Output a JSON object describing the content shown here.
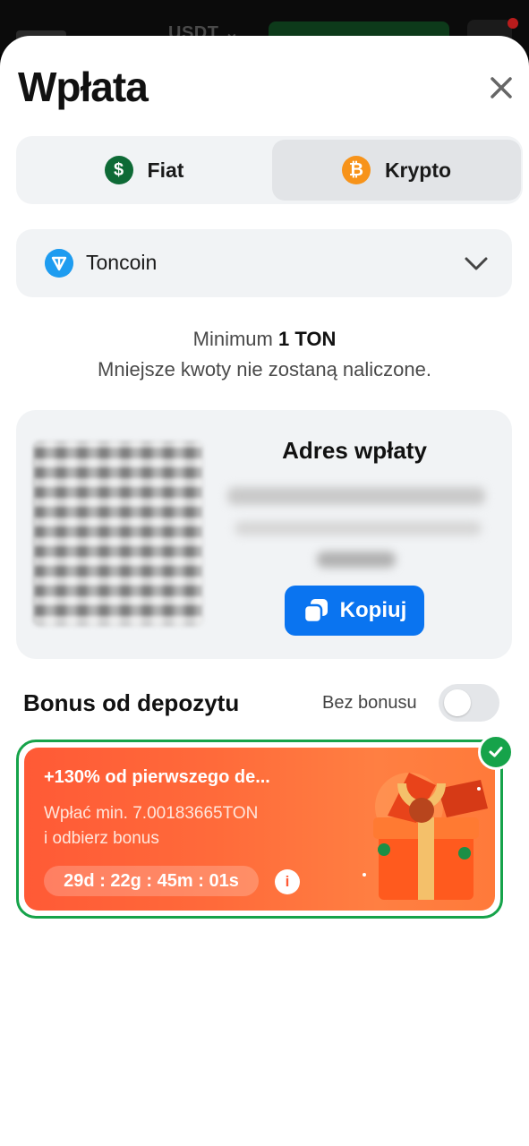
{
  "backdrop": {
    "currency": "USDT"
  },
  "modal": {
    "title": "Wpłata",
    "tabs": [
      {
        "label": "Fiat",
        "icon": "dollar-coin-icon",
        "selected": false
      },
      {
        "label": "Krypto",
        "icon": "bitcoin-icon",
        "selected": true
      }
    ],
    "coin_select": {
      "value": "Toncoin",
      "icon": "toncoin-icon"
    },
    "minimum": {
      "prefix": "Minimum",
      "amount": "1 TON",
      "note": "Mniejsze kwoty nie zostaną naliczone."
    },
    "address_card": {
      "title": "Adres wpłaty",
      "copy_label": "Kopiuj"
    },
    "bonus_section": {
      "title": "Bonus od depozytu",
      "no_bonus_label": "Bez bonusu",
      "no_bonus_toggle_on": false,
      "card": {
        "headline": "+130% od pierwszego de...",
        "line1": "Wpłać min. 7.00183665TON",
        "line2": "i odbierz bonus",
        "timer": "29d : 22g : 45m : 01s",
        "selected": true
      }
    }
  },
  "colors": {
    "accent_blue": "#0a74f0",
    "success_green": "#16a34a",
    "bonus_orange": "#ff6a3a",
    "fiat_green": "#0e6a36",
    "bitcoin_orange": "#f7931a",
    "ton_blue": "#1e9cf0"
  }
}
